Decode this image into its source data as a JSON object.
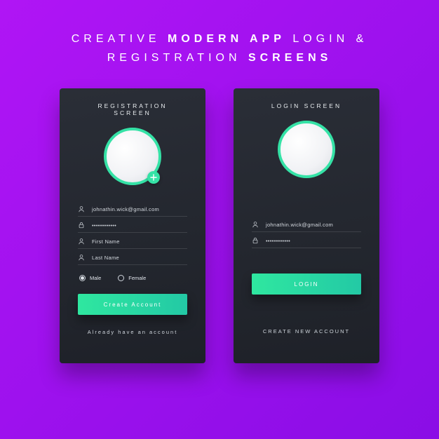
{
  "heading": {
    "l1a": "CREATIVE ",
    "l1b": "MODERN APP",
    "l1c": " LOGIN &",
    "l2a": "REGISTRATION ",
    "l2b": "SCREENS"
  },
  "reg": {
    "title": "REGISTRATION SCREEN",
    "email": "johnathin.wick@gmail.com",
    "password_mask": "••••••••••••",
    "first_name": "First Name",
    "last_name": "Last Name",
    "gender_male": "Male",
    "gender_female": "Female",
    "cta": "Create Account",
    "sub": "Already have an account"
  },
  "login": {
    "title": "LOGIN SCREEN",
    "email": "johnathin.wick@gmail.com",
    "password_mask": "••••••••••••",
    "cta": "LOGIN",
    "sub": "CREATE NEW ACCOUNT"
  }
}
